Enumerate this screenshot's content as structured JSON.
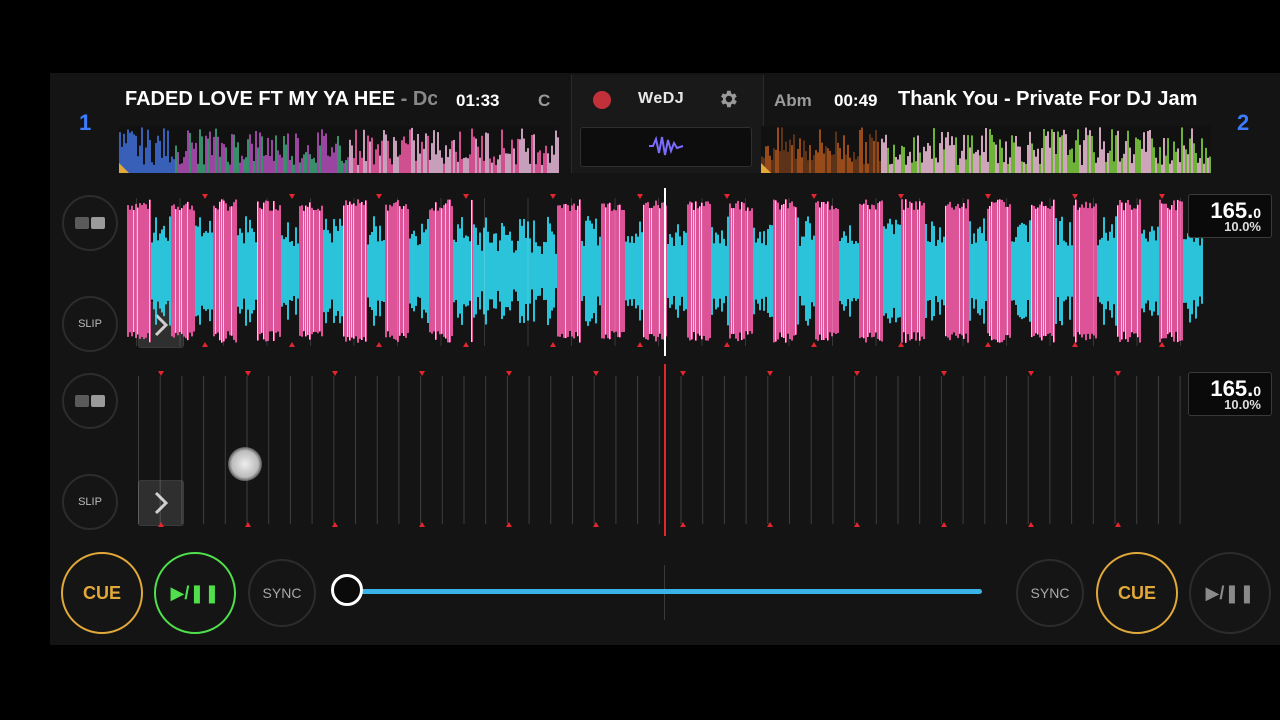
{
  "header": {
    "deck1": {
      "number": "1",
      "title": "FADED LOVE FT MY YA HEE",
      "artist_sep": " - ",
      "artist": "Dc",
      "time": "01:33",
      "key": "C"
    },
    "deck2": {
      "number": "2",
      "title": "Thank You - Private For DJ Jam",
      "time": "00:49",
      "key": "Abm"
    },
    "app_name": "WeDJ",
    "icons": {
      "record": "record-dot-icon",
      "settings": "gear-icon",
      "waveform": "waveform-icon"
    }
  },
  "deck1": {
    "slip_label": "SLIP",
    "bpm_main": "165.",
    "bpm_dec": "0",
    "pitch": "10.0%"
  },
  "deck2": {
    "slip_label": "SLIP",
    "bpm_main": "165.",
    "bpm_dec": "0",
    "pitch": "10.0%"
  },
  "transport": {
    "cue_left": "CUE",
    "play_left": "▶/❚❚",
    "sync_left": "SYNC",
    "sync_right": "SYNC",
    "cue_right": "CUE",
    "play_right": "▶/❚❚"
  },
  "colors": {
    "accent_blue": "#3d7cff",
    "cue_orange": "#e1a83a",
    "play_green": "#4fe04c",
    "wave_pink": "#f25aa6",
    "wave_cyan": "#2ed6ef",
    "crossfader": "#3ab4e8",
    "playhead_red": "#e2262e"
  }
}
